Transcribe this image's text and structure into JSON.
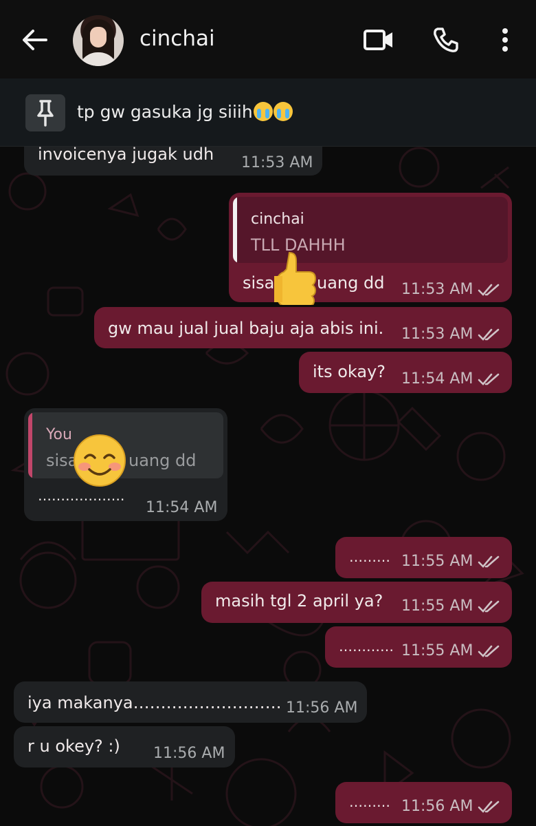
{
  "header": {
    "contact_name": "cinchai",
    "back_icon": "back-arrow-icon",
    "video_icon": "video-call-icon",
    "call_icon": "phone-icon",
    "menu_icon": "more-vert-icon"
  },
  "pinned": {
    "icon": "pin-icon",
    "text": "tp gw gasuka jg siiih",
    "emojis": [
      "loudly-crying-face",
      "loudly-crying-face"
    ]
  },
  "colors": {
    "outgoing_bubble": "#6a1a30",
    "incoming_bubble": "#1f2123",
    "quote_out_bg": "#55162a",
    "quote_in_bg": "#2e3133",
    "quote_out_bar": "#f2f2f2",
    "quote_in_bar": "#c1466a",
    "read_ticks": "#cfc3c7"
  },
  "messages": [
    {
      "id": "m1",
      "dir": "in",
      "text": "invoicenya jugak udh",
      "time": "11:53 AM"
    },
    {
      "id": "m2",
      "dir": "out",
      "quote_author": "cinchai",
      "quote_text": "TLL DAHHH",
      "text": "sisa",
      "text_tail": "uang dd",
      "time": "11:53 AM",
      "sticker": "thumbs-up"
    },
    {
      "id": "m3",
      "dir": "out",
      "text": "gw mau jual jual baju aja abis ini.",
      "time": "11:53 AM"
    },
    {
      "id": "m4",
      "dir": "out",
      "text": "its okay?",
      "time": "11:54 AM"
    },
    {
      "id": "m5",
      "dir": "in",
      "quote_author": "You",
      "quote_text": "sisa",
      "quote_tail": "uang dd",
      "text": "……………….",
      "time": "11:54 AM",
      "sticker": "smiling-face"
    },
    {
      "id": "m6",
      "dir": "out",
      "text": "………",
      "time": "11:55 AM"
    },
    {
      "id": "m7",
      "dir": "out",
      "text": "masih tgl 2 april ya?",
      "time": "11:55 AM"
    },
    {
      "id": "m8",
      "dir": "out",
      "text": "…………",
      "time": "11:55 AM"
    },
    {
      "id": "m9",
      "dir": "in",
      "text": "iya makanya………………………",
      "time": "11:56 AM"
    },
    {
      "id": "m10",
      "dir": "in",
      "text": "r u okey? :)",
      "time": "11:56 AM"
    },
    {
      "id": "m11",
      "dir": "out",
      "text": "………",
      "time": "11:56 AM"
    }
  ]
}
